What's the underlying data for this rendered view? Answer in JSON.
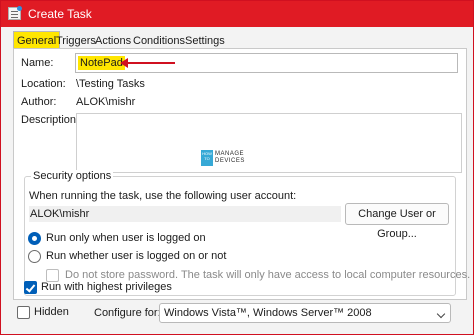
{
  "window": {
    "title": "Create Task",
    "app_icon": "task-scheduler-icon"
  },
  "tabs": [
    {
      "label": "General",
      "active": true
    },
    {
      "label": "Triggers",
      "active": false
    },
    {
      "label": "Actions",
      "active": false
    },
    {
      "label": "Conditions",
      "active": false
    },
    {
      "label": "Settings",
      "active": false
    }
  ],
  "general": {
    "name_label": "Name:",
    "name_value": "NotePad",
    "location_label": "Location:",
    "location_value": "\\Testing Tasks",
    "author_label": "Author:",
    "author_value": "ALOK\\mishr",
    "description_label": "Description:",
    "description_value": ""
  },
  "watermark": {
    "how": "HOW TO",
    "line1": "MANAGE",
    "line2": "DEVICES"
  },
  "security": {
    "legend": "Security options",
    "account_prompt": "When running the task, use the following user account:",
    "account_value": "ALOK\\mishr",
    "change_button": "Change User or Group...",
    "radio_logged_on": "Run only when user is logged on",
    "radio_any": "Run whether user is logged on or not",
    "no_store_password": "Do not store password.  The task will only have access to local computer resources.",
    "highest_privileges": "Run with highest privileges"
  },
  "footer": {
    "hidden_label": "Hidden",
    "configure_label": "Configure for:",
    "configure_value": "Windows Vista™, Windows Server™ 2008"
  },
  "colors": {
    "titlebar": "#e01b24",
    "highlight": "#ffe600",
    "accent": "#005fb8",
    "arrow": "#d01020"
  }
}
